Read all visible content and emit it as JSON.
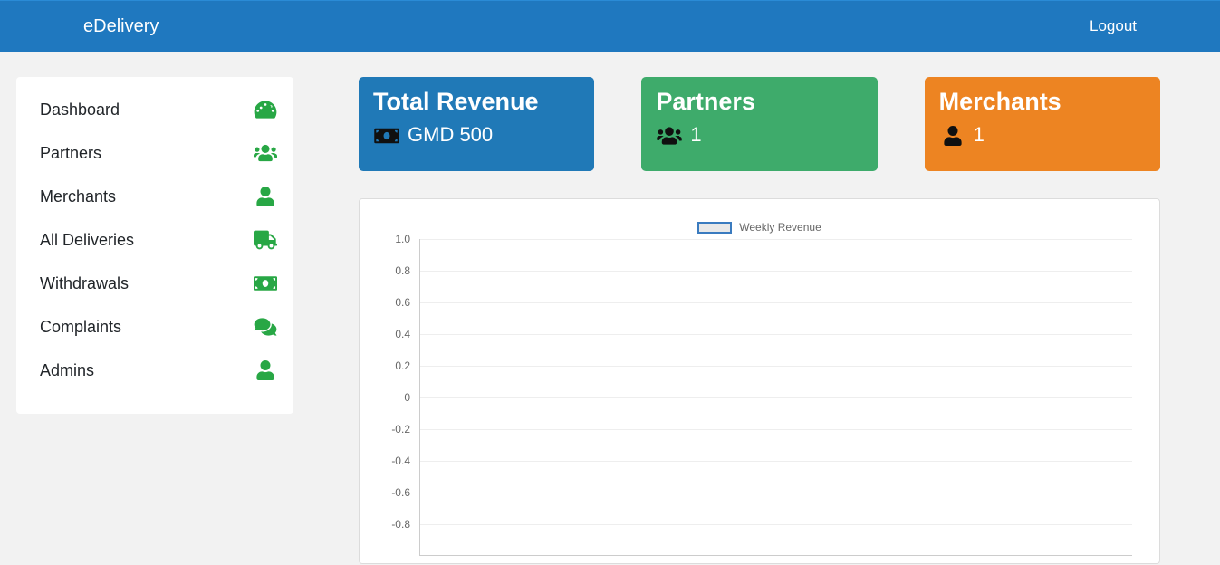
{
  "header": {
    "brand": "eDelivery",
    "logout": "Logout"
  },
  "sidebar": {
    "items": [
      {
        "label": "Dashboard",
        "icon": "tachometer-icon"
      },
      {
        "label": "Partners",
        "icon": "users-icon"
      },
      {
        "label": "Merchants",
        "icon": "user-icon"
      },
      {
        "label": "All Deliveries",
        "icon": "truck-icon"
      },
      {
        "label": "Withdrawals",
        "icon": "money-bill-icon"
      },
      {
        "label": "Complaints",
        "icon": "comments-icon"
      },
      {
        "label": "Admins",
        "icon": "user-icon"
      }
    ]
  },
  "cards": {
    "revenue": {
      "title": "Total Revenue",
      "value": "GMD 500",
      "icon": "money-bill-icon",
      "color": "#2079b7"
    },
    "partners": {
      "title": "Partners",
      "value": "1",
      "icon": "users-icon",
      "color": "#3eab6b"
    },
    "merchants": {
      "title": "Merchants",
      "value": "1",
      "icon": "user-icon",
      "color": "#ed8422"
    }
  },
  "chart_data": {
    "type": "line",
    "title": "",
    "legend": "Weekly Revenue",
    "series": [
      {
        "name": "Weekly Revenue",
        "values": []
      }
    ],
    "x": [],
    "ylabel": "",
    "xlabel": "",
    "ylim": [
      -1.0,
      1.0
    ],
    "yticks": [
      1.0,
      0.8,
      0.6,
      0.4,
      0.2,
      0,
      -0.2,
      -0.4,
      -0.6,
      -0.8
    ]
  }
}
